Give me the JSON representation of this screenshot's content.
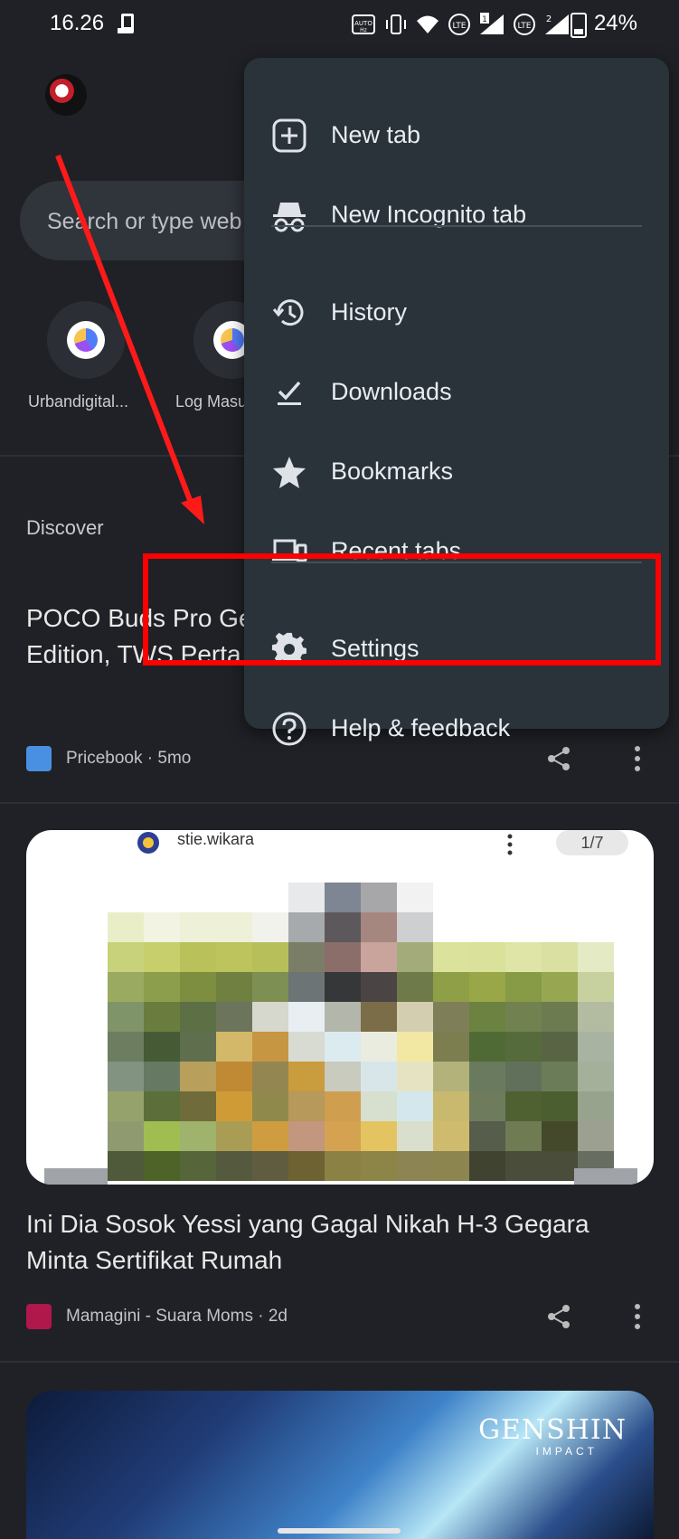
{
  "status_bar": {
    "time": "16.26",
    "battery": "24%",
    "icons": [
      "phone-icon",
      "auto-hz-icon",
      "vibrate-icon",
      "wifi-icon",
      "volte-icon",
      "signal-1-icon",
      "volte-icon",
      "signal-2-icon",
      "battery-icon"
    ]
  },
  "search": {
    "placeholder": "Search or type web address"
  },
  "shortcuts": [
    {
      "label": "Urbandigital..."
    },
    {
      "label": "Log Masuk"
    }
  ],
  "discover": {
    "title": "Discover",
    "articles": [
      {
        "title_line1": "POCO Buds Pro Ge",
        "title_line2": "Edition, TWS Perta",
        "source": "Pricebook · 5mo",
        "source_color": "#4a90e2"
      },
      {
        "image_caption": "stie.wikara",
        "image_badge": "1/7",
        "title_line1": "Ini Dia Sosok Yessi yang Gagal Nikah H-3 Gegara",
        "title_line2": "Minta Sertifikat Rumah",
        "source": "Mamagini - Suara Moms · 2d",
        "source_color": "#b0174b"
      },
      {
        "image_logo": "GENSHIN",
        "image_logo_sub": "IMPACT"
      }
    ]
  },
  "menu": {
    "items": [
      {
        "label": "New tab",
        "icon": "plus-box-icon"
      },
      {
        "label": "New Incognito tab",
        "icon": "incognito-icon"
      },
      {
        "label": "History",
        "icon": "history-icon"
      },
      {
        "label": "Downloads",
        "icon": "download-icon"
      },
      {
        "label": "Bookmarks",
        "icon": "star-icon"
      },
      {
        "label": "Recent tabs",
        "icon": "devices-icon"
      },
      {
        "label": "Settings",
        "icon": "gear-icon"
      },
      {
        "label": "Help & feedback",
        "icon": "help-icon"
      }
    ]
  },
  "colors": {
    "background": "#1f2126",
    "menu_bg": "#2a323a",
    "annotation": "#ff0000"
  }
}
